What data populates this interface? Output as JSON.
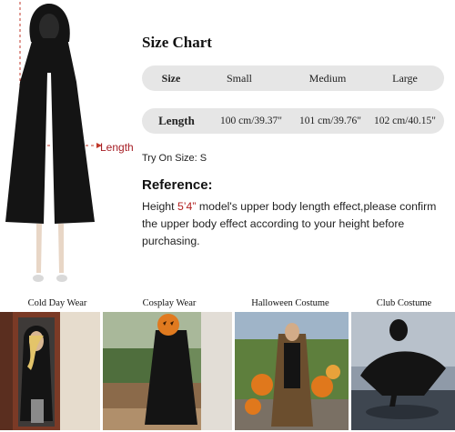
{
  "figure": {
    "length_label": "Length"
  },
  "size_chart": {
    "title": "Size Chart",
    "header": [
      "Size",
      "Small",
      "Medium",
      "Large"
    ],
    "length_row": [
      "Length",
      "100 cm/39.37\"",
      "101 cm/39.76\"",
      "102 cm/40.15\""
    ]
  },
  "try_on": "Try On Size: S",
  "reference": {
    "title": "Reference:",
    "text_before": "Height ",
    "height": "5’4”",
    "text_after": " model's upper body length effect,please confirm the upper body effect according to your height before purchasing."
  },
  "photos": [
    {
      "caption": "Cold Day Wear"
    },
    {
      "caption": "Cosplay Wear"
    },
    {
      "caption": "Halloween Costume"
    },
    {
      "caption": "Club Costume"
    }
  ],
  "colors": {
    "accent_red": "#a61d24",
    "row_bg": "#e6e6e6",
    "cloak": "#141414"
  }
}
